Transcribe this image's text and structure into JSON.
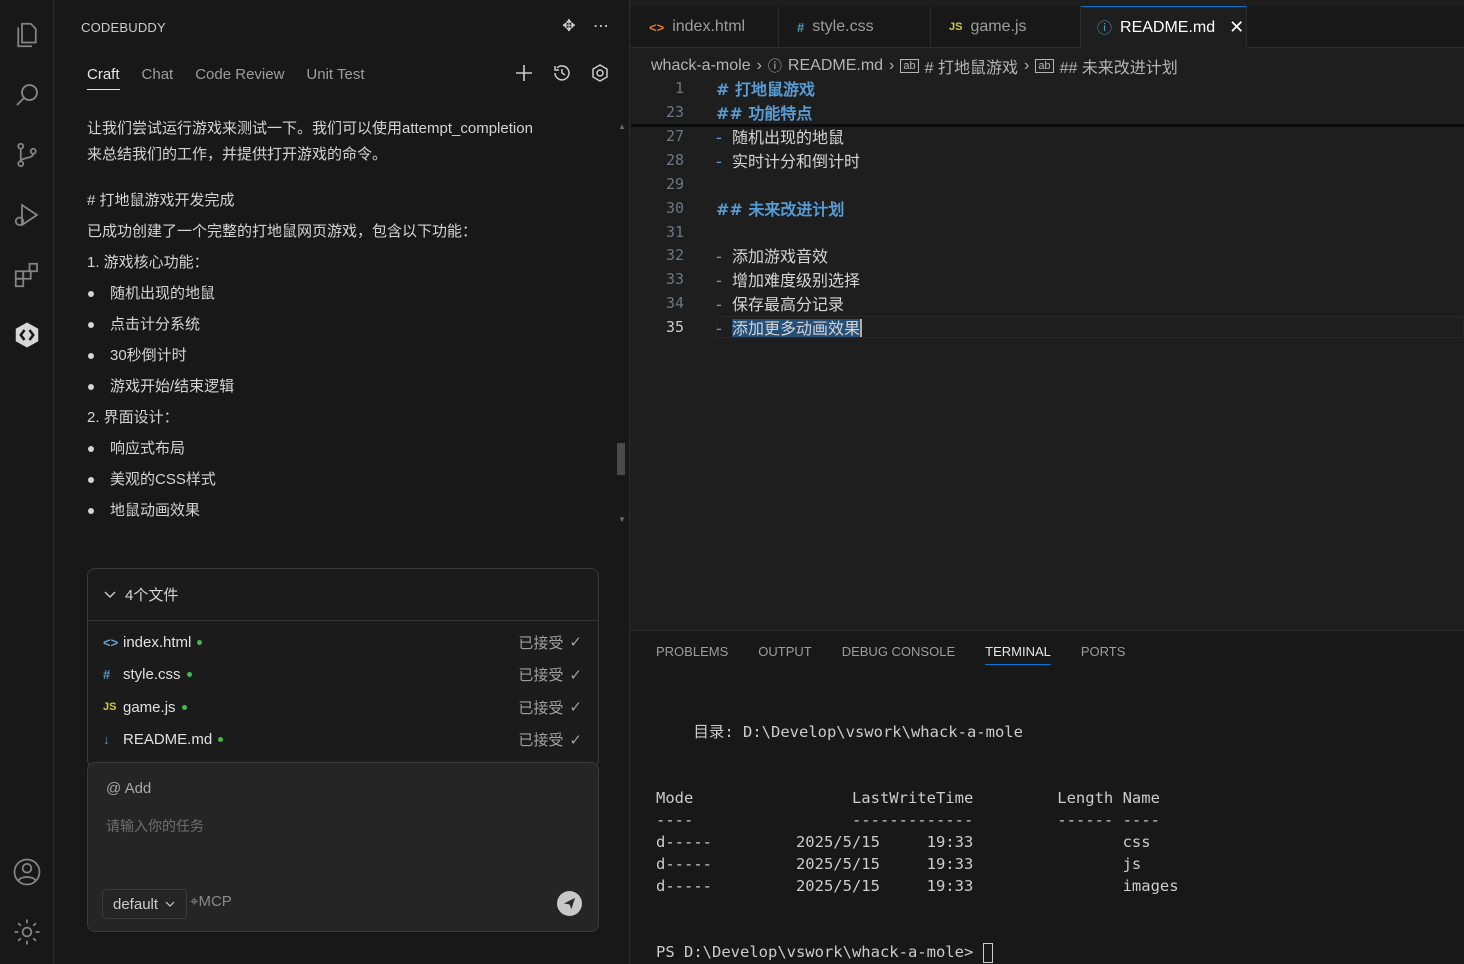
{
  "activity_bar": {
    "items": [
      "files-icon",
      "search-icon",
      "source-control-icon",
      "run-debug-icon",
      "extensions-icon",
      "codebuddy-icon"
    ],
    "bottom": [
      "account-icon",
      "settings-gear-icon"
    ]
  },
  "side_panel": {
    "title": "CODEBUDDY",
    "tabs": [
      {
        "label": "Craft",
        "active": true
      },
      {
        "label": "Chat",
        "active": false
      },
      {
        "label": "Code Review",
        "active": false
      },
      {
        "label": "Unit Test",
        "active": false
      }
    ],
    "messages": {
      "intro_line1": "让我们尝试运行游戏来测试一下。我们可以使用attempt_completion",
      "intro_line2": "来总结我们的工作，并提供打开游戏的命令。",
      "heading": "# 打地鼠游戏开发完成",
      "summary": "已成功创建了一个完整的打地鼠网页游戏，包含以下功能：",
      "section1": "1. 游戏核心功能：",
      "section1_items": [
        "随机出现的地鼠",
        "点击计分系统",
        "30秒倒计时",
        "游戏开始/结束逻辑"
      ],
      "section2": "2. 界面设计：",
      "section2_items": [
        "响应式布局",
        "美观的CSS样式",
        "地鼠动画效果"
      ]
    },
    "files": {
      "header": "4个文件",
      "items": [
        {
          "name": "index.html",
          "icon": "<>",
          "status": "已接受"
        },
        {
          "name": "style.css",
          "icon": "#",
          "status": "已接受"
        },
        {
          "name": "game.js",
          "icon": "JS",
          "status": "已接受"
        },
        {
          "name": "README.md",
          "icon": "↓",
          "status": "已接受"
        }
      ]
    },
    "input": {
      "add_label": "@ Add",
      "placeholder": "请输入你的任务",
      "model": "default",
      "mcp_label": "MCP"
    }
  },
  "editor": {
    "tabs": [
      {
        "label": "index.html",
        "icon": "<>",
        "icon_color": "#e37933",
        "active": false
      },
      {
        "label": "style.css",
        "icon": "#",
        "icon_color": "#519aba",
        "active": false
      },
      {
        "label": "game.js",
        "icon": "JS",
        "icon_color": "#cbcb41",
        "active": false
      },
      {
        "label": "README.md",
        "icon": "ⓘ",
        "icon_color": "#519aba",
        "active": true
      }
    ],
    "breadcrumb": [
      "whack-a-mole",
      "README.md",
      "# 打地鼠游戏",
      "## 未来改进计划"
    ],
    "lines": [
      {
        "num": "1",
        "dash": "",
        "text": "# 打地鼠游戏",
        "heading": true
      },
      {
        "num": "23",
        "dash": "",
        "text": "## 功能特点",
        "heading": true
      },
      {
        "num": "27",
        "dash": "-",
        "text": "随机出现的地鼠",
        "heading": false
      },
      {
        "num": "28",
        "dash": "-",
        "text": "实时计分和倒计时",
        "heading": false
      },
      {
        "num": "29",
        "dash": "",
        "text": "",
        "heading": false
      },
      {
        "num": "30",
        "dash": "",
        "text": "## 未来改进计划",
        "heading": true
      },
      {
        "num": "31",
        "dash": "",
        "text": "",
        "heading": false
      },
      {
        "num": "32",
        "dash": "-",
        "text": "添加游戏音效",
        "heading": false
      },
      {
        "num": "33",
        "dash": "-",
        "text": "增加难度级别选择",
        "heading": false
      },
      {
        "num": "34",
        "dash": "-",
        "text": "保存最高分记录",
        "heading": false
      },
      {
        "num": "35",
        "dash": "-",
        "text": "添加更多动画效果",
        "heading": false
      }
    ]
  },
  "panel": {
    "tabs": [
      {
        "label": "PROBLEMS",
        "active": false
      },
      {
        "label": "OUTPUT",
        "active": false
      },
      {
        "label": "DEBUG CONSOLE",
        "active": false
      },
      {
        "label": "TERMINAL",
        "active": true
      },
      {
        "label": "PORTS",
        "active": false
      }
    ],
    "terminal": {
      "dir_line": "    目录: D:\\Develop\\vswork\\whack-a-mole",
      "header": "Mode                 LastWriteTime         Length Name",
      "sep": "----                 -------------         ------ ----",
      "rows": [
        "d-----         2025/5/15     19:33                css",
        "d-----         2025/5/15     19:33                js",
        "d-----         2025/5/15     19:33                images"
      ],
      "prompt": "PS D:\\Develop\\vswork\\whack-a-mole> "
    }
  }
}
